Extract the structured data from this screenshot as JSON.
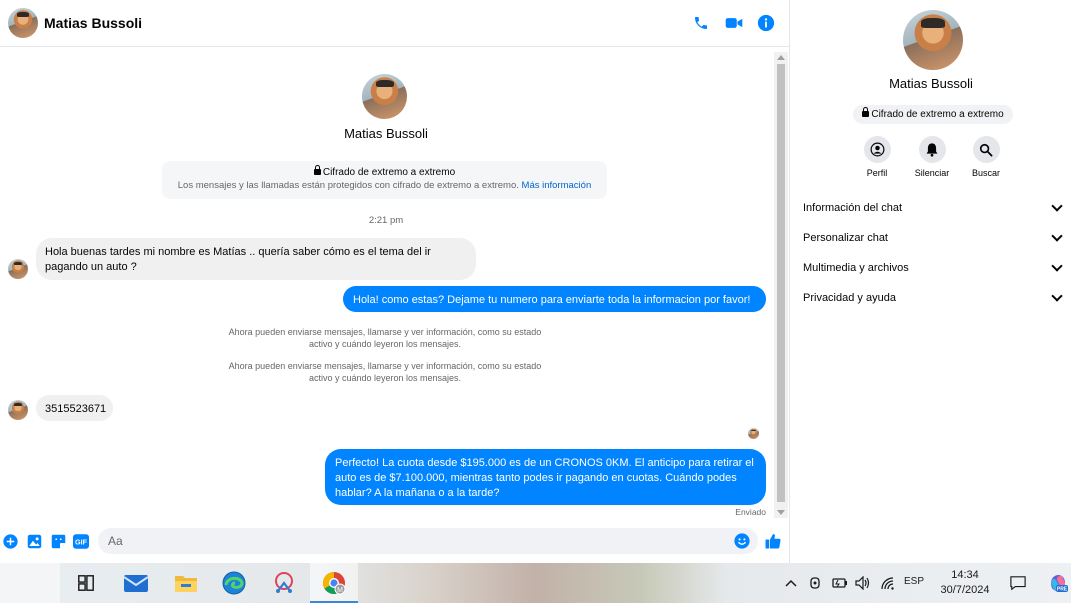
{
  "colors": {
    "accent": "#0084ff",
    "link": "#0064d1",
    "bubble_in": "#f0f0f0",
    "muted_text": "#65676b"
  },
  "header": {
    "contact_name": "Matias Bussoli",
    "icons": [
      "phone-icon",
      "video-icon",
      "info-icon"
    ]
  },
  "intro": {
    "contact_name": "Matias Bussoli",
    "e2e_title": "Cifrado de extremo a extremo",
    "e2e_desc": "Los mensajes y las llamadas están protegidos con cifrado de extremo a extremo.",
    "e2e_link": "Más información"
  },
  "messages": {
    "time_label": "2:21 pm",
    "in1": "Hola buenas tardes mi nombre es Matías .. quería saber cómo es el tema del ir pagando un auto ?",
    "out1": "Hola! como estas? Dejame tu numero para enviarte toda la informacion por favor!",
    "sys1": "Ahora pueden enviarse mensajes, llamarse y ver información, como su estado activo y cuándo leyeron los mensajes.",
    "sys2": "Ahora pueden enviarse mensajes, llamarse y ver información, como su estado activo y cuándo leyeron los mensajes.",
    "in2": "3515523671",
    "out2": "Perfecto! La cuota desde $195.000 es de un CRONOS 0KM. El anticipo para retirar el auto es de $7.100.000, mientras tanto podes ir pagando en cuotas. Cuándo podes hablar? A la mañana o a la tarde?",
    "sent_label": "Enviado"
  },
  "composer": {
    "placeholder": "Aa",
    "value": ""
  },
  "panel": {
    "contact_name": "Matias Bussoli",
    "e2e_badge": "Cifrado de extremo a extremo",
    "actions": [
      {
        "label": "Perfil",
        "icon": "profile-icon"
      },
      {
        "label": "Silenciar",
        "icon": "bell-icon"
      },
      {
        "label": "Buscar",
        "icon": "search-icon"
      }
    ],
    "sections": [
      {
        "label": "Información del chat"
      },
      {
        "label": "Personalizar chat"
      },
      {
        "label": "Multimedia y archivos"
      },
      {
        "label": "Privacidad y ayuda"
      }
    ]
  },
  "taskbar": {
    "apps": [
      "widgets-icon",
      "mail-icon",
      "file-explorer-icon",
      "edge-icon",
      "snipping-tool-icon",
      "chrome-icon"
    ],
    "chrome_profile_letter": "M",
    "language": "ESP",
    "time": "14:34",
    "date": "30/7/2024",
    "copilot_badge": "PRE"
  }
}
